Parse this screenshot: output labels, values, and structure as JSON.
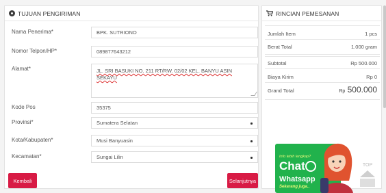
{
  "shipping": {
    "title": "TUJUAN PENGIRIMAN",
    "fields": [
      {
        "label": "Nama Penerima*",
        "value": "BPK. SUTRIONO"
      },
      {
        "label": "Nomor Telpon/HP*",
        "value": "089877643212"
      },
      {
        "label": "Alamat*",
        "value": "JL. SRI BASUKI NO. 211 RT/RW. 02/02 KEL. BANYU ASIN",
        "value2": "SEKAYU"
      },
      {
        "label": "Kode Pos",
        "value": "35375"
      },
      {
        "label": "Provinsi*",
        "value": "Sumatera Selatan"
      },
      {
        "label": "Kota/Kabupaten*",
        "value": "Musi Banyuasin"
      },
      {
        "label": "Kecamatan*",
        "value": "Sungai Lilin"
      }
    ],
    "back_label": "Kembali",
    "next_label": "Selanjutnya"
  },
  "order": {
    "title": "RINCIAN PEMESANAN",
    "rows": [
      {
        "k": "Jumlah Item",
        "v": "1 pcs"
      },
      {
        "k": "Berat Total",
        "v": "1.000 gram"
      },
      {
        "k": "Subtotal",
        "v": "Rp 500.000"
      },
      {
        "k": "Biaya Kirim",
        "v": "Rp 0"
      }
    ],
    "total_label": "Grand Total",
    "total_currency": "Rp",
    "total_value": "500.000"
  },
  "whatsapp": {
    "line1": "Info lebih lengkap?",
    "line2": "Chat",
    "line3": "Whatsapp",
    "line4": "Sekarang juga.."
  },
  "top_label": "TOP",
  "colors": {
    "accent": "#d81b45",
    "whatsapp": "#21b24c"
  },
  "icons": {
    "shipping": "radio-dot-icon",
    "order": "cart-icon"
  }
}
